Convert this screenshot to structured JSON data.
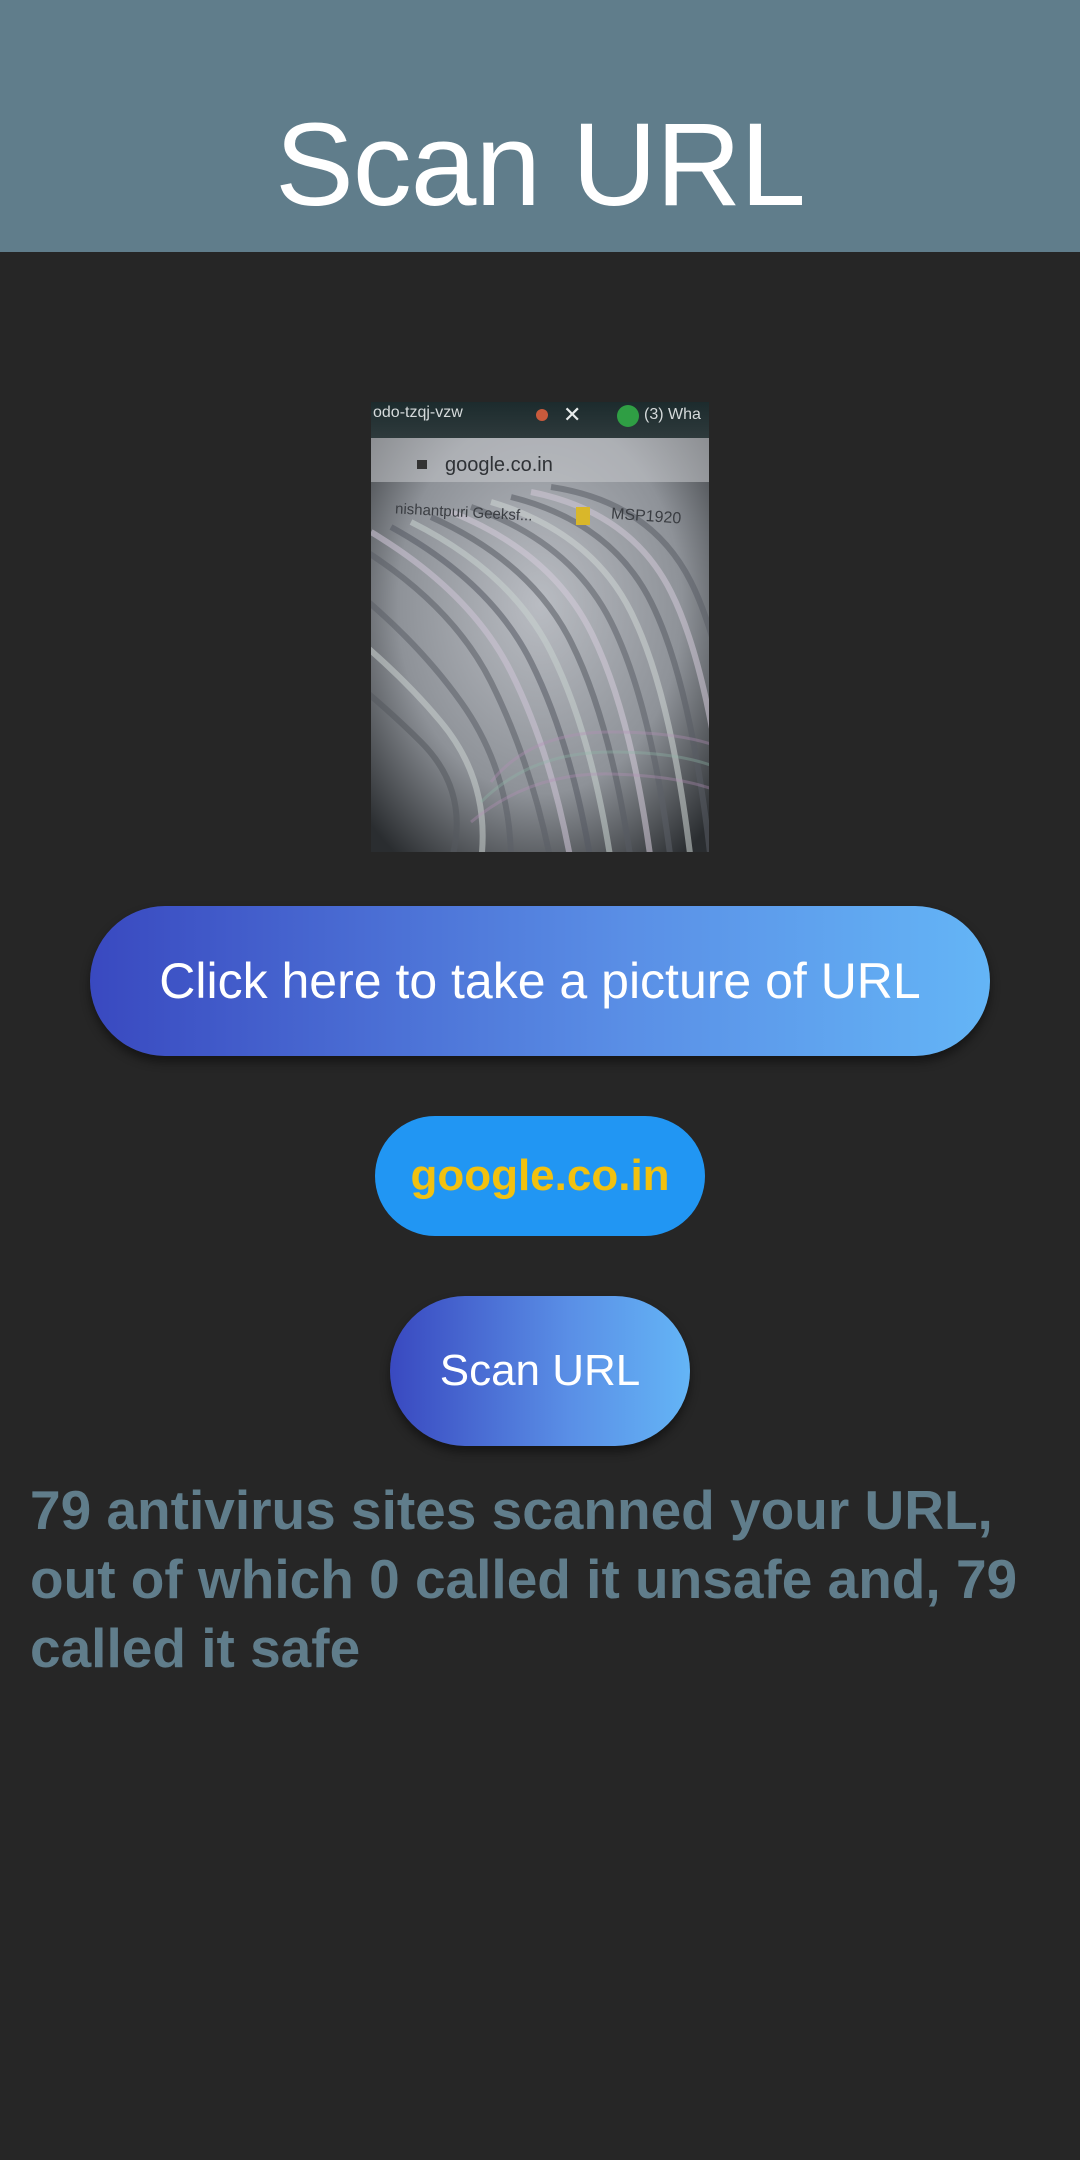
{
  "app_bar": {
    "title": "Scan URL",
    "color": "#607d8b"
  },
  "captured_photo": {
    "tab_text": "odo-tzqj-vzw",
    "whatsapp_text": "(3) Wha",
    "address_text": "google.co.in",
    "bookmark_1": "nishantpuri Geeksf...",
    "bookmark_2": "MSP1920"
  },
  "take_picture_button": {
    "label": "Click here to take a picture of URL"
  },
  "detected_url": {
    "label": "google.co.in",
    "text_color": "#f2c10f",
    "background": "#2196f3"
  },
  "scan_button": {
    "label": "Scan URL"
  },
  "result": {
    "text": "79 antivirus sites scanned your URL, out of which 0 called it unsafe and, 79 called it safe",
    "color": "#607d8b"
  },
  "background": "#262626"
}
